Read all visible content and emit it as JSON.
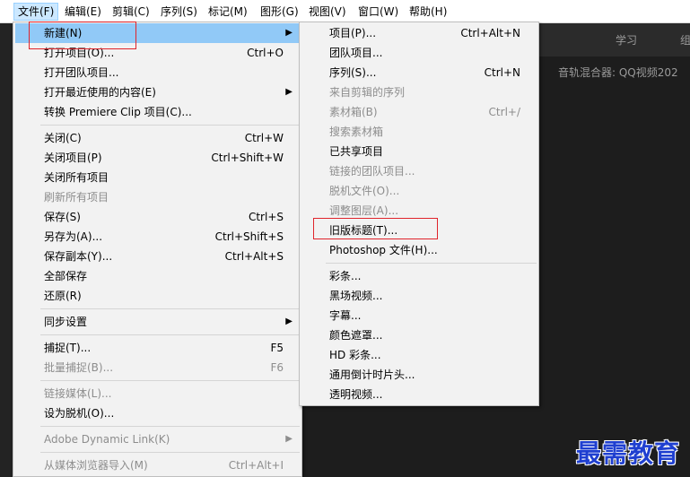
{
  "menubar": {
    "items": [
      {
        "label": "文件(F)",
        "active": true
      },
      {
        "label": "编辑(E)"
      },
      {
        "label": "剪辑(C)"
      },
      {
        "label": "序列(S)"
      },
      {
        "label": "标记(M)"
      },
      {
        "label": "图形(G)"
      },
      {
        "label": "视图(V)"
      },
      {
        "label": "窗口(W)"
      },
      {
        "label": "帮助(H)"
      }
    ]
  },
  "workspace": {
    "tabs": [
      "学习",
      "组"
    ],
    "panel_title": "音轨混合器: QQ视频202"
  },
  "file_menu": {
    "items": [
      {
        "label": "新建(N)",
        "submenu": true,
        "highlighted": true
      },
      {
        "label": "打开项目(O)...",
        "shortcut": "Ctrl+O"
      },
      {
        "label": "打开团队项目..."
      },
      {
        "label": "打开最近使用的内容(E)",
        "submenu": true
      },
      {
        "label": "转换 Premiere Clip 项目(C)..."
      },
      {
        "label": "关闭(C)",
        "shortcut": "Ctrl+W"
      },
      {
        "label": "关闭项目(P)",
        "shortcut": "Ctrl+Shift+W"
      },
      {
        "label": "关闭所有项目"
      },
      {
        "label": "刷新所有项目",
        "disabled": true
      },
      {
        "label": "保存(S)",
        "shortcut": "Ctrl+S"
      },
      {
        "label": "另存为(A)...",
        "shortcut": "Ctrl+Shift+S"
      },
      {
        "label": "保存副本(Y)...",
        "shortcut": "Ctrl+Alt+S"
      },
      {
        "label": "全部保存"
      },
      {
        "label": "还原(R)"
      },
      {
        "label": "同步设置",
        "submenu": true
      },
      {
        "label": "捕捉(T)...",
        "shortcut": "F5"
      },
      {
        "label": "批量捕捉(B)...",
        "shortcut": "F6",
        "disabled": true
      },
      {
        "label": "链接媒体(L)...",
        "disabled": true
      },
      {
        "label": "设为脱机(O)..."
      },
      {
        "label": "Adobe Dynamic Link(K)",
        "submenu": true,
        "disabled": true
      },
      {
        "label": "从媒体浏览器导入(M)",
        "shortcut": "Ctrl+Alt+I",
        "disabled": true
      }
    ]
  },
  "new_submenu": {
    "items": [
      {
        "label": "项目(P)...",
        "shortcut": "Ctrl+Alt+N"
      },
      {
        "label": "团队项目..."
      },
      {
        "label": "序列(S)...",
        "shortcut": "Ctrl+N"
      },
      {
        "label": "来自剪辑的序列",
        "disabled": true
      },
      {
        "label": "素材箱(B)",
        "shortcut": "Ctrl+/",
        "disabled": true
      },
      {
        "label": "搜索素材箱",
        "disabled": true
      },
      {
        "label": "已共享项目"
      },
      {
        "label": "链接的团队项目...",
        "disabled": true
      },
      {
        "label": "脱机文件(O)...",
        "disabled": true
      },
      {
        "label": "调整图层(A)...",
        "disabled": true
      },
      {
        "label": "旧版标题(T)..."
      },
      {
        "label": "Photoshop 文件(H)..."
      },
      {
        "label": "彩条..."
      },
      {
        "label": "黑场视频..."
      },
      {
        "label": "字幕..."
      },
      {
        "label": "颜色遮罩..."
      },
      {
        "label": "HD 彩条..."
      },
      {
        "label": "通用倒计时片头..."
      },
      {
        "label": "透明视频..."
      }
    ]
  },
  "watermark": "最需教育",
  "colors": {
    "highlight": "#91c9f7",
    "annotation": "#e0242b",
    "watermark": "#1f3fd0"
  }
}
